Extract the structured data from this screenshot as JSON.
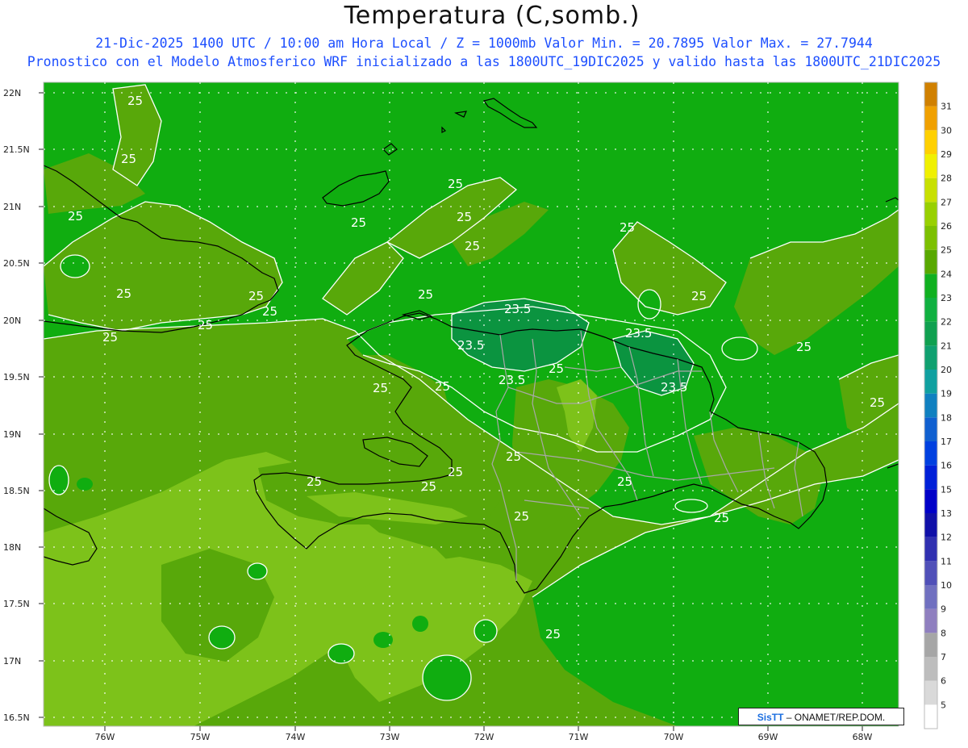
{
  "header": {
    "title": "Temperatura (C,somb.)",
    "line1": "21-Dic-2025 1400 UTC / 10:00 am Hora Local / Z = 1000mb  Valor Min. = 20.7895  Valor Max. = 27.7944",
    "line2": "Pronostico con el Modelo Atmosferico WRF inicializado a las 1800UTC_19DIC2025 y valido hasta las  1800UTC_21DIC2025"
  },
  "axes": {
    "lat_labels": [
      "22N",
      "21.5N",
      "21N",
      "20.5N",
      "20N",
      "19.5N",
      "19N",
      "18.5N",
      "18N",
      "17.5N",
      "17N",
      "16.5N"
    ],
    "lon_labels": [
      "76W",
      "75W",
      "74W",
      "73W",
      "72W",
      "71W",
      "70W",
      "69W",
      "68W"
    ]
  },
  "colorbar": {
    "levels": [
      "5",
      "6",
      "7",
      "8",
      "9",
      "10",
      "11",
      "12",
      "13",
      "15",
      "16",
      "17",
      "18",
      "19",
      "20",
      "21",
      "22",
      "23",
      "24",
      "25",
      "26",
      "27",
      "28",
      "29",
      "30",
      "31"
    ],
    "colors": [
      "#ffffff",
      "#d9d9d9",
      "#bdbdbd",
      "#a6a6a6",
      "#8f7fbf",
      "#7070c0",
      "#5050b8",
      "#3030b0",
      "#1010a8",
      "#0000c8",
      "#0020d8",
      "#0040e0",
      "#1060d0",
      "#1080c0",
      "#10a0a0",
      "#10a070",
      "#10a050",
      "#10b040",
      "#10b020",
      "#58a800",
      "#7cc000",
      "#98d000",
      "#c8e000",
      "#f0f000",
      "#ffd000",
      "#f0a000",
      "#d08000"
    ]
  },
  "contour_labels": [
    "25",
    "25",
    "25",
    "25",
    "25",
    "25",
    "25",
    "25",
    "25",
    "25",
    "25",
    "25",
    "25",
    "25",
    "25",
    "25",
    "25",
    "25",
    "25",
    "25",
    "25",
    "25",
    "25",
    "23.5",
    "23.5",
    "23.5",
    "23.5",
    "23.5",
    "25",
    "25",
    "25",
    "25",
    "25"
  ],
  "credit": {
    "logo": "SisTT",
    "text": " – ONAMET/REP.DOM."
  },
  "colors": {
    "sea_24": "#10ad10",
    "band_25": "#58a80a",
    "band_26": "#7dc21a",
    "band_27": "#9ed42a",
    "band_23": "#0b9440",
    "title_blue": "#1d4fff"
  }
}
